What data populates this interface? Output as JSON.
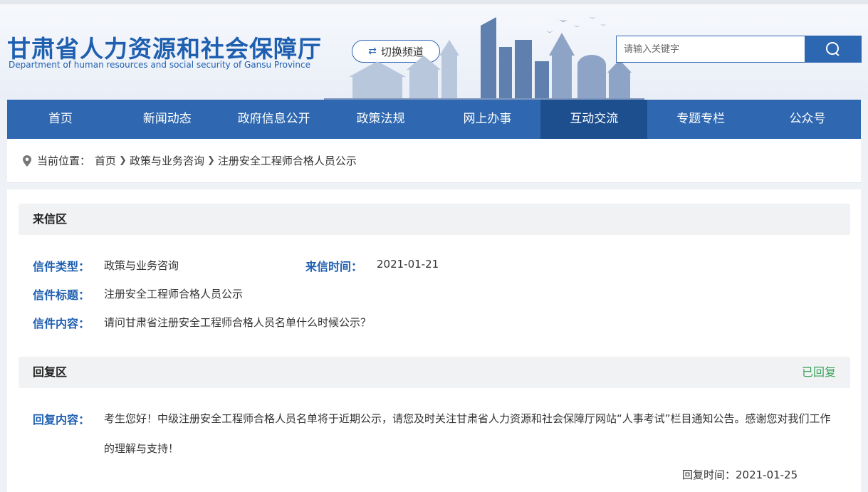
{
  "header": {
    "title_cn": "甘肃省人力资源和社会保障厅",
    "title_en": "Department of human resources and social security of Gansu Province",
    "switch_label": "切换频道",
    "search_placeholder": "请输入关键字"
  },
  "nav": {
    "items": [
      {
        "label": "首页"
      },
      {
        "label": "新闻动态"
      },
      {
        "label": "政府信息公开"
      },
      {
        "label": "政策法规"
      },
      {
        "label": "网上办事"
      },
      {
        "label": "互动交流"
      },
      {
        "label": "专题专栏"
      },
      {
        "label": "公众号"
      }
    ],
    "active_index": 5
  },
  "breadcrumb": {
    "prefix": "当前位置：",
    "items": [
      "首页",
      "政策与业务咨询",
      "注册安全工程师合格人员公示"
    ]
  },
  "letter": {
    "section_title": "来信区",
    "type_label": "信件类型：",
    "type_value": "政策与业务咨询",
    "time_label": "来信时间：",
    "time_value": "2021-01-21",
    "subject_label": "信件标题：",
    "subject_value": "注册安全工程师合格人员公示",
    "content_label": "信件内容：",
    "content_value": "请问甘肃省注册安全工程师合格人员名单什么时候公示？"
  },
  "reply": {
    "section_title": "回复区",
    "status": "已回复",
    "content_label": "回复内容：",
    "content_value": "考生您好！中级注册安全工程师合格人员名单将于近期公示，请您及时关注甘肃省人力资源和社会保障厅网站“人事考试”栏目通知公告。感谢您对我们工作的理解与支持！",
    "time_text": "回复时间：2021-01-25"
  },
  "colors": {
    "brand_blue": "#2f68b0",
    "nav_active": "#1d4f8f",
    "label_blue": "#1f5fb0",
    "status_green": "#3aa35a"
  }
}
